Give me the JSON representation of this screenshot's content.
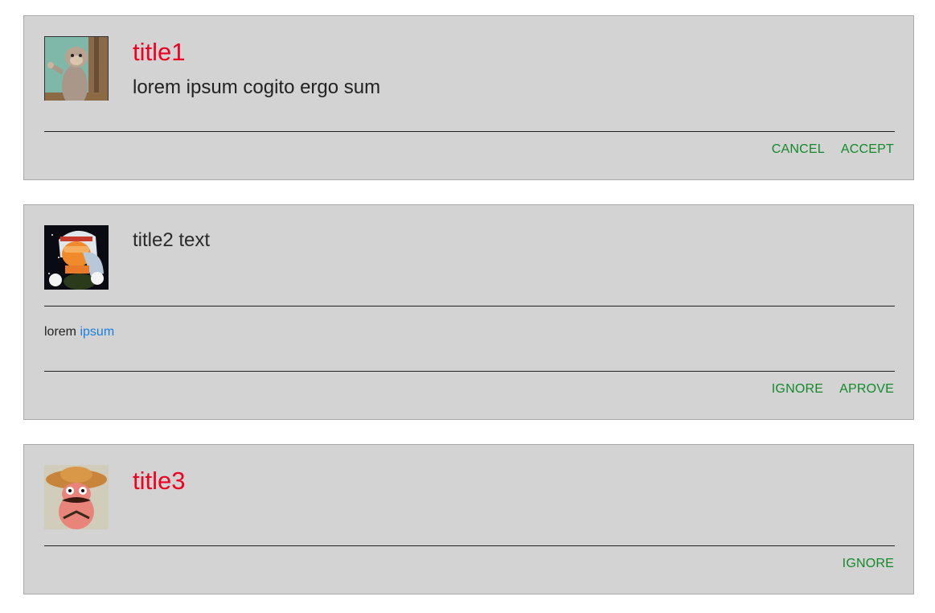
{
  "cards": [
    {
      "title": "title1",
      "subtitle": "lorem ipsum cogito ergo sum",
      "actions": [
        "CANCEL",
        "ACCEPT"
      ]
    },
    {
      "title": "title2 text",
      "body": {
        "text": "lorem",
        "link": "ipsum"
      },
      "actions": [
        "IGNORE",
        "APROVE"
      ]
    },
    {
      "title": "title3",
      "actions": [
        "IGNORE"
      ]
    }
  ],
  "colors": {
    "card_bg": "#d3d3d3",
    "title_accent": "#f00020",
    "action_green": "#128a2a",
    "link_blue": "#1a7fe0"
  }
}
